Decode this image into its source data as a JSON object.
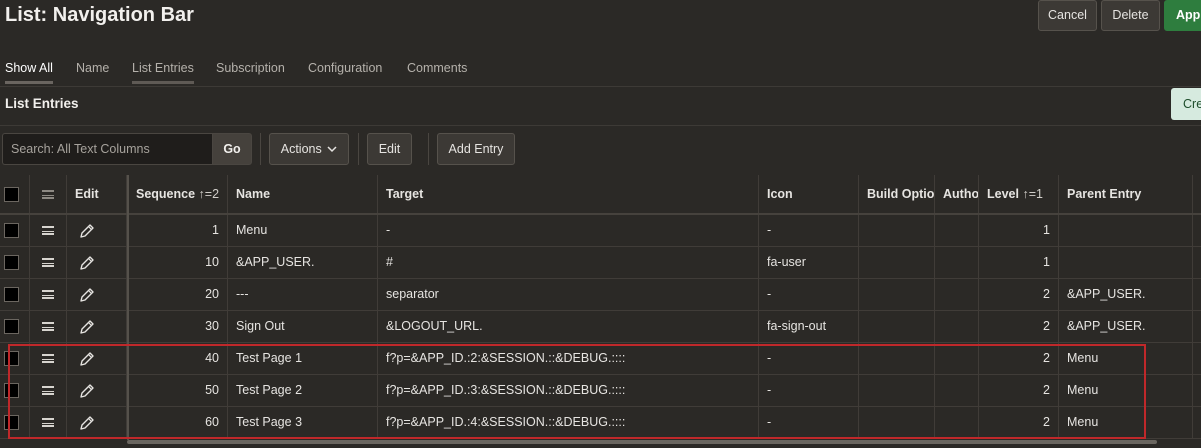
{
  "page": {
    "title": "List: Navigation Bar",
    "buttons": {
      "cancel": "Cancel",
      "delete": "Delete",
      "apply": "Appl"
    }
  },
  "tabs": [
    "Show All",
    "Name",
    "List Entries",
    "Subscription",
    "Configuration",
    "Comments"
  ],
  "region": {
    "title": "List Entries",
    "create_label": "Cre"
  },
  "toolbar": {
    "search_placeholder": "Search: All Text Columns",
    "go": "Go",
    "actions": "Actions",
    "edit": "Edit",
    "add_entry": "Add Entry"
  },
  "grid": {
    "headers": {
      "edit": "Edit",
      "sequence": "Sequence",
      "sequence_sort": "↑=2",
      "name": "Name",
      "target": "Target",
      "icon": "Icon",
      "build_option": "Build Option",
      "author": "Autho",
      "level": "Level",
      "level_sort": "↑=1",
      "parent": "Parent Entry"
    },
    "rows": [
      {
        "sequence": "1",
        "name": "Menu",
        "target": "-",
        "icon": "-",
        "build_option": "",
        "author": "",
        "level": "1",
        "parent": ""
      },
      {
        "sequence": "10",
        "name": "&APP_USER.",
        "target": "#",
        "icon": "fa-user",
        "build_option": "",
        "author": "",
        "level": "1",
        "parent": ""
      },
      {
        "sequence": "20",
        "name": "---",
        "target": "separator",
        "icon": "-",
        "build_option": "",
        "author": "",
        "level": "2",
        "parent": "&APP_USER."
      },
      {
        "sequence": "30",
        "name": "Sign Out",
        "target": "&LOGOUT_URL.",
        "icon": "fa-sign-out",
        "build_option": "",
        "author": "",
        "level": "2",
        "parent": "&APP_USER."
      },
      {
        "sequence": "40",
        "name": "Test Page 1",
        "target": "f?p=&APP_ID.:2:&SESSION.::&DEBUG.::::",
        "icon": "-",
        "build_option": "",
        "author": "",
        "level": "2",
        "parent": "Menu"
      },
      {
        "sequence": "50",
        "name": "Test Page 2",
        "target": "f?p=&APP_ID.:3:&SESSION.::&DEBUG.::::",
        "icon": "-",
        "build_option": "",
        "author": "",
        "level": "2",
        "parent": "Menu"
      },
      {
        "sequence": "60",
        "name": "Test Page 3",
        "target": "f?p=&APP_ID.:4:&SESSION.::&DEBUG.::::",
        "icon": "-",
        "build_option": "",
        "author": "",
        "level": "2",
        "parent": "Menu"
      }
    ]
  },
  "colors": {
    "accent_green": "#2e7d3e",
    "highlight_red": "#c0282a",
    "background": "#2b2926"
  },
  "icons": [
    "checkbox-icon",
    "drag-handle-icon",
    "pencil-icon",
    "chevron-down-icon",
    "sort-ascending-icon"
  ]
}
